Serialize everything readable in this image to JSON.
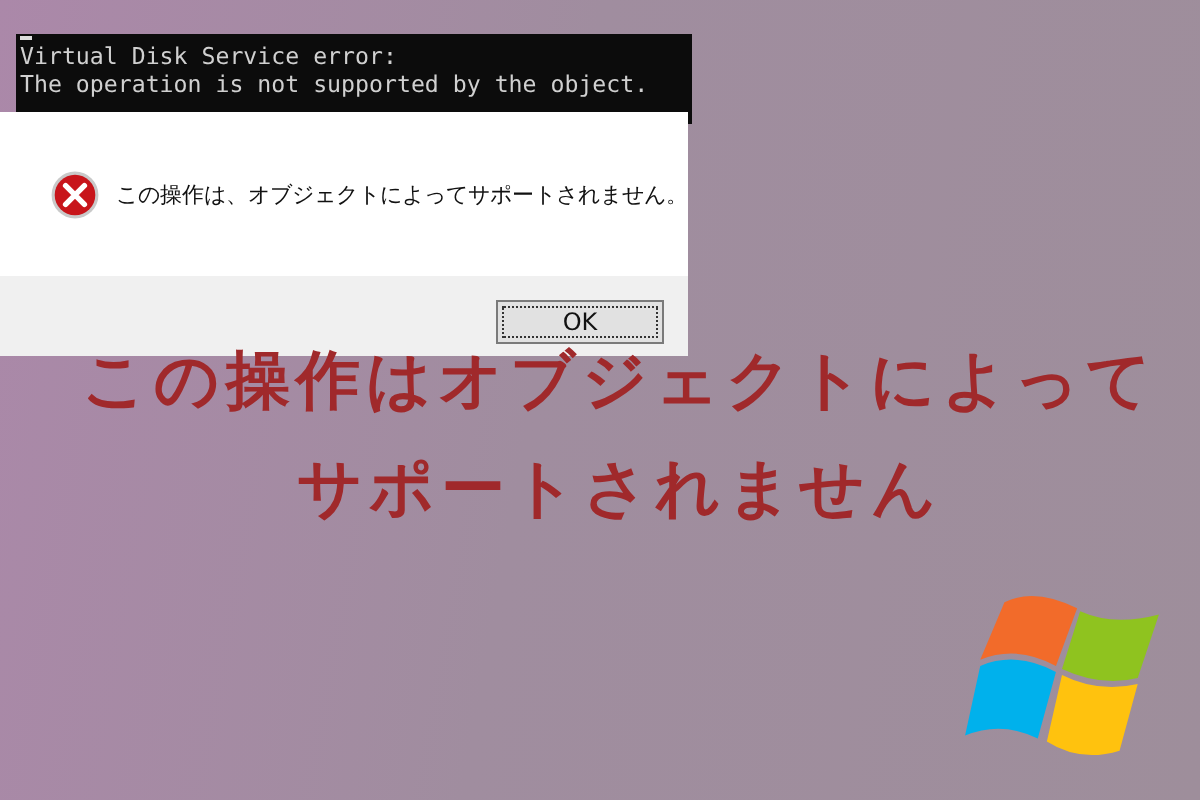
{
  "console": {
    "lines": [
      "Virtual Disk Service error:",
      "The operation is not supported by the object."
    ]
  },
  "dialog": {
    "message": "この操作は、オブジェクトによってサポートされません。",
    "buttons": [
      "OK"
    ]
  },
  "headline": [
    "この操作はオブジェクトによって",
    "サポートされません"
  ]
}
